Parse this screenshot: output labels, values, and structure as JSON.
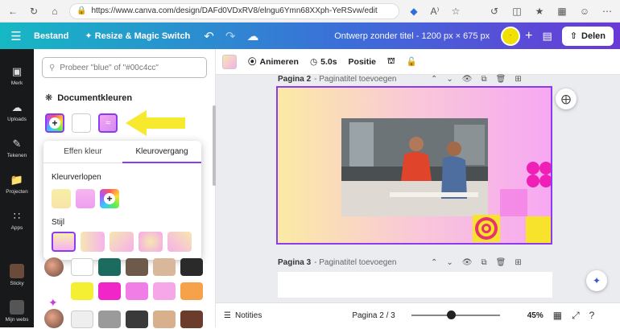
{
  "browser": {
    "url": "https://www.canva.com/design/DAFd0VDxRV8/elngu6Ymn68XXph-YeRSvw/edit",
    "icons": [
      "back-icon",
      "refresh-icon",
      "home-icon",
      "lock-icon",
      "tag-icon",
      "read-aloud-icon",
      "star-icon",
      "extensions-icon",
      "split-icon",
      "favorites-icon",
      "collections-icon",
      "profile-icon",
      "more-icon"
    ]
  },
  "topbar": {
    "file_label": "Bestand",
    "resize_label": "Resize & Magic Switch",
    "title": "Ontwerp zonder titel - 1200 px × 675 px",
    "avatar_text": "-",
    "share_label": "Delen"
  },
  "rail": {
    "items": [
      {
        "label": "Merk",
        "icon": "brand-icon"
      },
      {
        "label": "Uploads",
        "icon": "upload-icon"
      },
      {
        "label": "Tekenen",
        "icon": "draw-icon"
      },
      {
        "label": "Projecten",
        "icon": "folder-icon"
      },
      {
        "label": "Apps",
        "icon": "apps-grid-icon"
      },
      {
        "label": "Sticky",
        "icon": "sticky-icon"
      },
      {
        "label": "Mijn webs",
        "icon": "web-icon"
      }
    ]
  },
  "panel": {
    "search_placeholder": "Probeer \"blue\" of \"#00c4cc\"",
    "doc_colors_title": "Documentkleuren"
  },
  "popup": {
    "tabs": [
      "Effen kleur",
      "Kleurovergang"
    ],
    "active_tab": "Kleurovergang",
    "gradients_label": "Kleurverlopen",
    "style_label": "Stijl"
  },
  "palette": {
    "row1": [
      "#ffffff",
      "#1b6b5f",
      "#6e5a4a",
      "#d8b79a",
      "#2a2a2a"
    ],
    "row2": [
      "#f5ef33",
      "#f026c9",
      "#f07ee6",
      "#f5a7e8",
      "#f5a24a"
    ],
    "row3": [
      "#eeeeee",
      "#9a9a9a",
      "#3a3a3a",
      "#d9b08c",
      "#6b3b2b"
    ]
  },
  "canvas_toolbar": {
    "animate_label": "Animeren",
    "duration_label": "5.0s",
    "position_label": "Positie"
  },
  "pages": {
    "page2_label": "Pagina 2",
    "page2_sub": "- Paginatitel toevoegen",
    "page3_label": "Pagina 3",
    "page3_sub": "- Paginatitel toevoegen"
  },
  "bottom": {
    "notes_label": "Notities",
    "page_indicator": "Pagina 2 / 3",
    "zoom": "45%"
  }
}
